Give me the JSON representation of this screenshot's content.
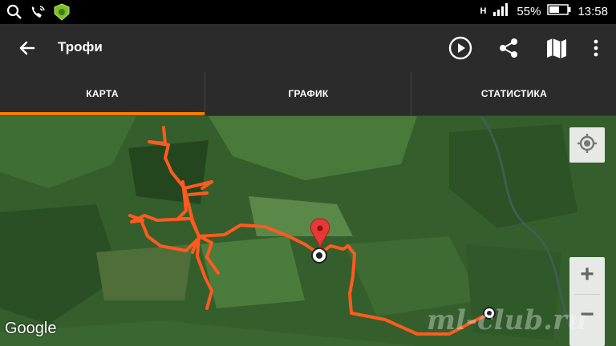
{
  "statusbar": {
    "network_label": "H",
    "battery_percent": "55%",
    "time": "13:58",
    "icons": [
      "search-icon",
      "wifi-call-icon",
      "app-badge-icon",
      "signal-icon",
      "battery-icon"
    ]
  },
  "appbar": {
    "title": "Трофи",
    "icons": [
      "back-arrow-icon",
      "play-icon",
      "share-icon",
      "map-icon",
      "more-vertical-icon"
    ]
  },
  "tabs": [
    {
      "label": "КАРТА",
      "active": true
    },
    {
      "label": "ГРАФИК",
      "active": false
    },
    {
      "label": "СТАТИСТИКА",
      "active": false
    }
  ],
  "map": {
    "attribution": "Google",
    "watermark": "ml-club.ru",
    "zoom_in_label": "+",
    "zoom_out_label": "−",
    "track_color": "#ff5a1f",
    "accent_color": "#ff7a00",
    "marker_color": "#e53935"
  }
}
